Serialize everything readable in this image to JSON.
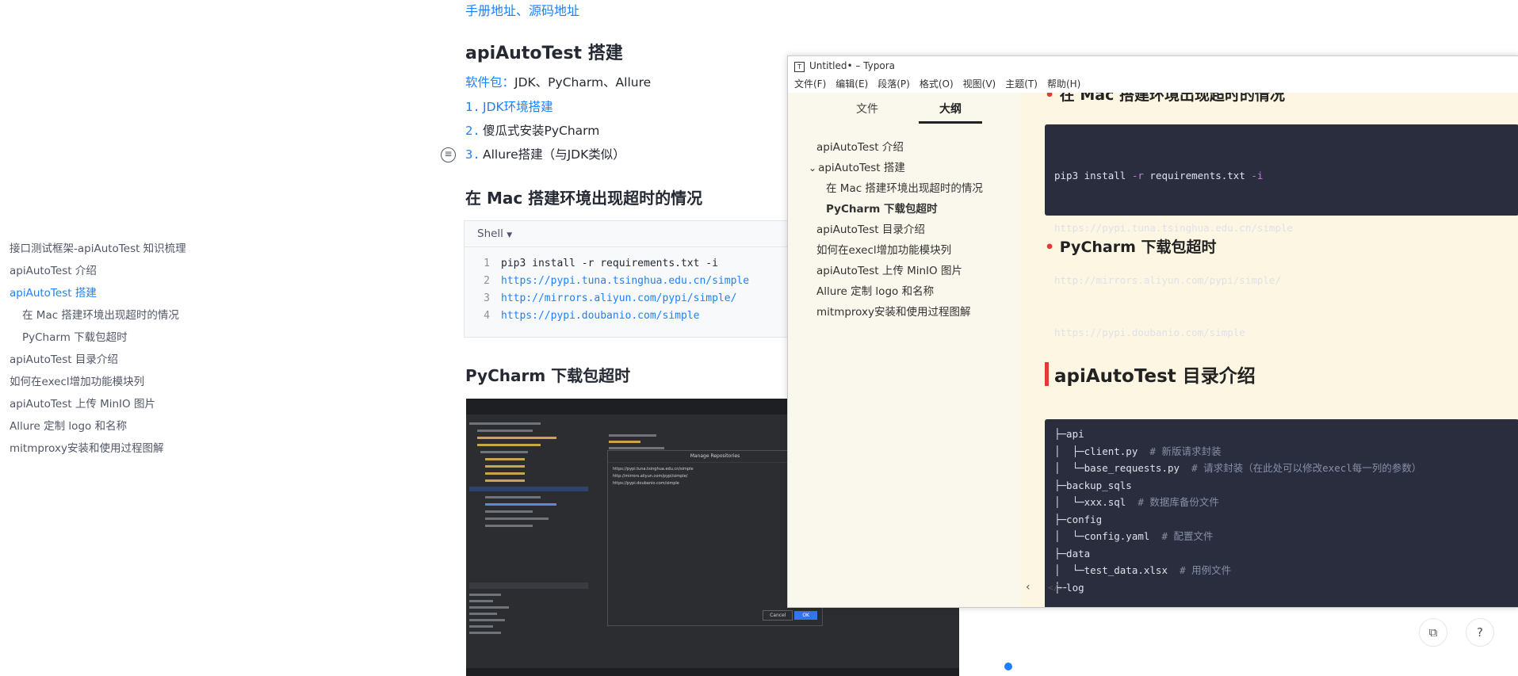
{
  "article": {
    "top_links": "手册地址、源码地址",
    "section1_title": "apiAutoTest 搭建",
    "software_prefix": "软件包：",
    "software_text": "JDK、PyCharm、Allure",
    "steps": [
      {
        "num": "1.",
        "text": "JDK环境搭建",
        "is_link": true
      },
      {
        "num": "2.",
        "text": "傻瓜式安装PyCharm",
        "is_link": false
      },
      {
        "num": "3.",
        "text": "Allure搭建（与JDK类似）",
        "is_link": false
      }
    ],
    "mac_title": "在 Mac 搭建环境出现超时的情况",
    "code_lang": "Shell",
    "code_lines": [
      {
        "n": "1",
        "text": "pip3 install -r requirements.txt -i",
        "is_link": false
      },
      {
        "n": "2",
        "text": "https://pypi.tuna.tsinghua.edu.cn/simple",
        "is_link": true
      },
      {
        "n": "3",
        "text": "http://mirrors.aliyun.com/pypi/simple/",
        "is_link": true
      },
      {
        "n": "4",
        "text": "https://pypi.doubanio.com/simple",
        "is_link": true
      }
    ],
    "pycharm_title": "PyCharm 下载包超时"
  },
  "toc": [
    {
      "label": "接口测试框架-apiAutoTest 知识梳理",
      "sub": false,
      "active": false
    },
    {
      "label": "apiAutoTest 介绍",
      "sub": false,
      "active": false
    },
    {
      "label": "apiAutoTest 搭建",
      "sub": false,
      "active": true
    },
    {
      "label": "在 Mac 搭建环境出现超时的情况",
      "sub": true,
      "active": false
    },
    {
      "label": "PyCharm 下载包超时",
      "sub": true,
      "active": false
    },
    {
      "label": "apiAutoTest 目录介绍",
      "sub": false,
      "active": false
    },
    {
      "label": "如何在execl增加功能模块列",
      "sub": false,
      "active": false
    },
    {
      "label": "apiAutoTest 上传 MinIO 图片",
      "sub": false,
      "active": false
    },
    {
      "label": "Allure 定制 logo 和名称",
      "sub": false,
      "active": false
    },
    {
      "label": "mitmproxy安装和使用过程图解",
      "sub": false,
      "active": false
    }
  ],
  "typora": {
    "window_title": "Untitled• – Typora",
    "menu": [
      "文件(F)",
      "编辑(E)",
      "段落(P)",
      "格式(O)",
      "视图(V)",
      "主题(T)",
      "帮助(H)"
    ],
    "tab_files": "文件",
    "tab_outline": "大纲",
    "outline": [
      {
        "label": "apiAutoTest 介绍",
        "level": 1,
        "bold": false,
        "expander": false
      },
      {
        "label": "apiAutoTest 搭建",
        "level": 1,
        "bold": false,
        "expander": true
      },
      {
        "label": "在 Mac 搭建环境出现超时的情况",
        "level": 2,
        "bold": false,
        "expander": false
      },
      {
        "label": "PyCharm 下载包超时",
        "level": 2,
        "bold": true,
        "expander": false
      },
      {
        "label": "apiAutoTest 目录介绍",
        "level": 1,
        "bold": false,
        "expander": false
      },
      {
        "label": "如何在execl增加功能模块列",
        "level": 1,
        "bold": false,
        "expander": false
      },
      {
        "label": "apiAutoTest 上传 MinIO 图片",
        "level": 1,
        "bold": false,
        "expander": false
      },
      {
        "label": "Allure 定制 logo 和名称",
        "level": 1,
        "bold": false,
        "expander": false
      },
      {
        "label": "mitmproxy安装和使用过程图解",
        "level": 1,
        "bold": false,
        "expander": false
      }
    ],
    "doc": {
      "cut_heading": "在 Mac 搭建环境出现超时的情况",
      "pip_cmd": "pip3 install ",
      "pip_flag_r": "-r",
      "pip_file": " requirements.txt ",
      "pip_flag_i": "-i",
      "mirror1": "https://pypi.tuna.tsinghua.edu.cn/simple",
      "mirror2": "http://mirrors.aliyun.com/pypi/simple/",
      "mirror3": "https://pypi.doubanio.com/simple",
      "pycharm_heading": "PyCharm 下载包超时",
      "dir_heading": "apiAutoTest 目录介绍",
      "tree": [
        {
          "code": "├─api",
          "comment": ""
        },
        {
          "code": "│  ├─client.py",
          "comment": "# 新版请求封装"
        },
        {
          "code": "│  └─base_requests.py",
          "comment": "# 请求封装（在此处可以修改execl每一列的参数）"
        },
        {
          "code": "├─backup_sqls",
          "comment": ""
        },
        {
          "code": "│  └─xxx.sql",
          "comment": "# 数据库备份文件"
        },
        {
          "code": "├─config",
          "comment": ""
        },
        {
          "code": "│  └─config.yaml",
          "comment": "# 配置文件"
        },
        {
          "code": "├─data",
          "comment": ""
        },
        {
          "code": "│  └─test_data.xlsx",
          "comment": "# 用例文件"
        },
        {
          "code": "├─log",
          "comment": ""
        }
      ]
    }
  },
  "ide_dialog": {
    "title": "Manage Repositories",
    "repos": [
      "https://pypi.tuna.tsinghua.edu.cn/simple",
      "http://mirrors.aliyun.com/pypi/simple/",
      "https://pypi.doubanio.com/simple"
    ],
    "cancel": "Cancel",
    "ok": "OK"
  },
  "colors": {
    "accent": "#1e80ff",
    "typora_side": "#faf7ec",
    "typora_doc": "#fdf6e3",
    "code_bg": "#2a2d3e",
    "heading_bar": "#e53935"
  }
}
